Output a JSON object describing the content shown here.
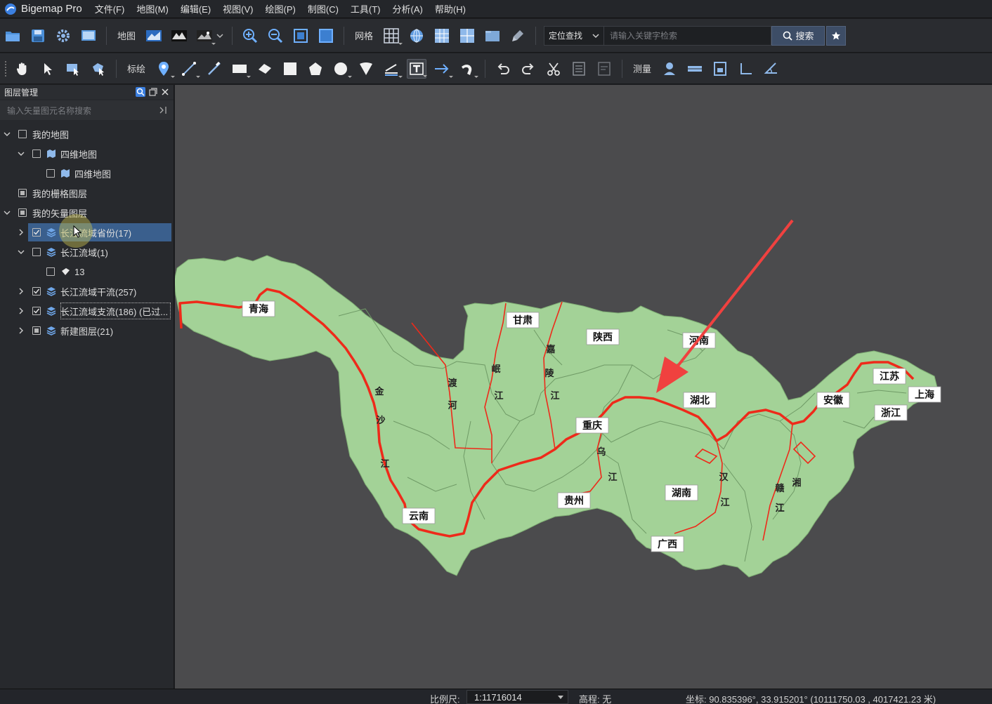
{
  "app": {
    "title": "Bigemap Pro"
  },
  "menu": [
    "文件(F)",
    "地图(M)",
    "编辑(E)",
    "视图(V)",
    "绘图(P)",
    "制图(C)",
    "工具(T)",
    "分析(A)",
    "帮助(H)"
  ],
  "toolbar1": {
    "map_label": "地图",
    "grid_label": "网格",
    "locate_label": "定位查找",
    "search_placeholder": "请输入关键字检索",
    "search_button": "搜索"
  },
  "toolbar2": {
    "plot_label": "标绘",
    "measure_label": "测量"
  },
  "layer_panel": {
    "title": "图层管理",
    "search_placeholder": "输入矢量图元名称搜索",
    "tree": [
      {
        "label": "我的地图",
        "level": 0,
        "expanded": true,
        "checked": false,
        "icon": "none"
      },
      {
        "label": "四维地图",
        "level": 1,
        "expanded": true,
        "checked": false,
        "icon": "map-icon"
      },
      {
        "label": "四维地图",
        "level": 2,
        "checked": false,
        "icon": "map-icon"
      },
      {
        "label": "我的栅格图层",
        "level": 0,
        "checked": "partial",
        "icon": "none"
      },
      {
        "label": "我的矢量图层",
        "level": 0,
        "expanded": true,
        "checked": "partial",
        "icon": "none"
      },
      {
        "label": "长江流域省份(17)",
        "level": 1,
        "expanded": false,
        "checked": true,
        "icon": "layers-icon",
        "selected": true
      },
      {
        "label": "长江流域(1)",
        "level": 1,
        "expanded": true,
        "checked": false,
        "icon": "layers-icon"
      },
      {
        "label": "13",
        "level": 2,
        "checked": false,
        "icon": "polygon-icon"
      },
      {
        "label": "长江流域干流(257)",
        "level": 1,
        "expanded": false,
        "checked": true,
        "icon": "layers-icon"
      },
      {
        "label": "长江流域支流(186) (已过...",
        "level": 1,
        "expanded": false,
        "checked": true,
        "icon": "layers-icon",
        "outlined": true
      },
      {
        "label": "新建图层(21)",
        "level": 1,
        "expanded": false,
        "checked": "partial",
        "icon": "layers-icon"
      }
    ]
  },
  "map": {
    "province_labels": [
      "青海",
      "甘肃",
      "陕西",
      "河南",
      "湖北",
      "重庆",
      "贵州",
      "湖南",
      "广西",
      "云南",
      "安徽",
      "江苏",
      "上海",
      "浙江"
    ],
    "river_labels": [
      "金",
      "沙",
      "江",
      "嘉",
      "陵",
      "江",
      "岷",
      "江",
      "渡",
      "河",
      "乌",
      "江",
      "汉",
      "江",
      "湘",
      "江",
      "赣",
      "江"
    ]
  },
  "statusbar": {
    "scale_label": "比例尺:",
    "scale_value": "1:11716014",
    "elevation": "高程: 无",
    "coords": "坐标: 90.835396°, 33.915201°  (10111750.03 , 4017421.23 米)"
  }
}
